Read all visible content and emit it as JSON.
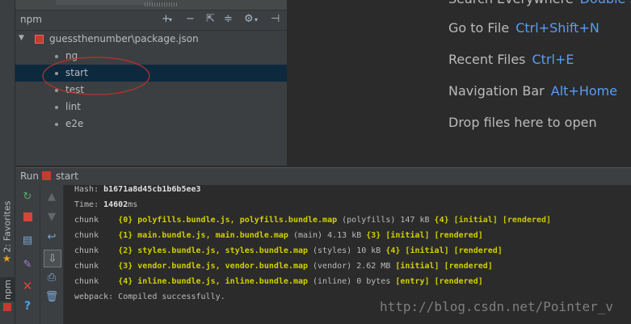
{
  "sidebar": {
    "favorites_label": "2: Favorites",
    "npm_label": "npm"
  },
  "npm_panel": {
    "title": "npm",
    "project": "guessthenumber\\package.json",
    "scripts": [
      "ng",
      "start",
      "test",
      "lint",
      "e2e"
    ],
    "selected": "start",
    "toolbar_icons": [
      "plus-icon",
      "minus-icon",
      "collapse-icon",
      "expand-icon",
      "gear-icon",
      "pin-icon"
    ]
  },
  "welcome": {
    "items": [
      {
        "label": "Search Everywhere",
        "shortcut": "Double Shift"
      },
      {
        "label": "Go to File",
        "shortcut": "Ctrl+Shift+N"
      },
      {
        "label": "Recent Files",
        "shortcut": "Ctrl+E"
      },
      {
        "label": "Navigation Bar",
        "shortcut": "Alt+Home"
      }
    ],
    "drop_text": "Drop files here to open"
  },
  "run": {
    "label": "Run",
    "config": "start"
  },
  "console": {
    "hash_label": "Hash: ",
    "hash_value": "b1671a8d45cb1b6b5ee3",
    "time_label": "Time: ",
    "time_value": "14602",
    "time_unit": "ms",
    "chunks": [
      {
        "prefix": "chunk    ",
        "id": "{0}",
        "files": "polyfills.bundle.js, polyfills.bundle.map",
        "name": " (polyfills) 147 kB ",
        "parent": "{4}",
        "flags": "[initial] [rendered]"
      },
      {
        "prefix": "chunk    ",
        "id": "{1}",
        "files": "main.bundle.js, main.bundle.map",
        "name": " (main) 4.13 kB ",
        "parent": "{3}",
        "flags": "[initial] [rendered]"
      },
      {
        "prefix": "chunk    ",
        "id": "{2}",
        "files": "styles.bundle.js, styles.bundle.map",
        "name": " (styles) 10 kB ",
        "parent": "{4}",
        "flags": "[initial] [rendered]"
      },
      {
        "prefix": "chunk    ",
        "id": "{3}",
        "files": "vendor.bundle.js, vendor.bundle.map",
        "name": " (vendor) 2.62 MB ",
        "parent": "",
        "flags": "[initial] [rendered]"
      },
      {
        "prefix": "chunk    ",
        "id": "{4}",
        "files": "inline.bundle.js, inline.bundle.map",
        "name": " (inline) 0 bytes ",
        "parent": "",
        "flags": "[entry] [rendered]"
      }
    ],
    "footer": "webpack: Compiled successfully."
  },
  "watermark": "http://blog.csdn.net/Pointer_v",
  "colors": {
    "shortcut": "#589df6",
    "highlight": "#d0d000",
    "selection": "#0d293e",
    "annotation": "#c03030"
  }
}
